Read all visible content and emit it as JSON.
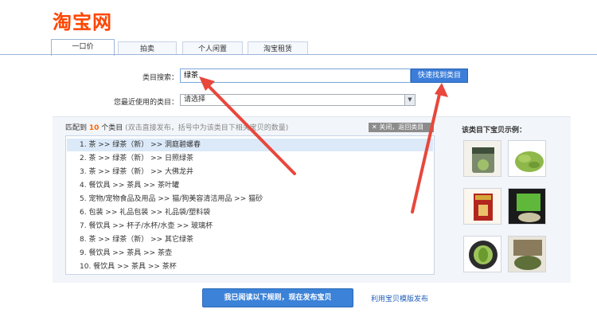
{
  "header": {
    "logo_text": "淘宝网"
  },
  "tabs": [
    {
      "label": "一口价",
      "active": true
    },
    {
      "label": "拍卖",
      "active": false
    },
    {
      "label": "个人闲置",
      "active": false
    },
    {
      "label": "淘宝租赁",
      "active": false
    }
  ],
  "category_search": {
    "label": "类目搜索：",
    "value": "绿茶",
    "button_label": "快速找到类目"
  },
  "recent_category": {
    "label": "您最近使用的类目：",
    "selected": "请选择"
  },
  "match": {
    "prefix": "匹配到",
    "count": "10",
    "suffix": "个类目",
    "hint": "(双击直接发布，括号中为该类目下相关宝贝的数量)",
    "close_label": "关闭，返回类目"
  },
  "results": [
    "1.  茶 >> 绿茶（新） >> 洞庭碧螺春",
    "2.  茶 >> 绿茶（新） >> 日照绿茶",
    "3.  茶 >> 绿茶（新） >> 大佛龙井",
    "4.  餐饮具 >> 茶具 >> 茶叶罐",
    "5.  宠物/宠物食品及用品 >> 猫/狗美容清洁用品 >> 猫砂",
    "6.  包装 >> 礼品包装 >> 礼品袋/塑料袋",
    "7.  餐饮具 >> 杯子/水杯/水壶 >> 玻璃杯",
    "8.  茶 >> 绿茶（新） >> 其它绿茶",
    "9.  餐饮具 >> 茶具 >> 茶壶",
    "10.  餐饮具 >> 茶具 >> 茶杯"
  ],
  "examples": {
    "label": "该类目下宝贝示例："
  },
  "actions": {
    "publish_label": "我已阅读以下规则，现在发布宝贝",
    "template_link": "利用宝贝模版发布"
  },
  "colors": {
    "brand": "#ff4400",
    "accent": "#3b7dd8",
    "arrow": "#e8473c"
  }
}
